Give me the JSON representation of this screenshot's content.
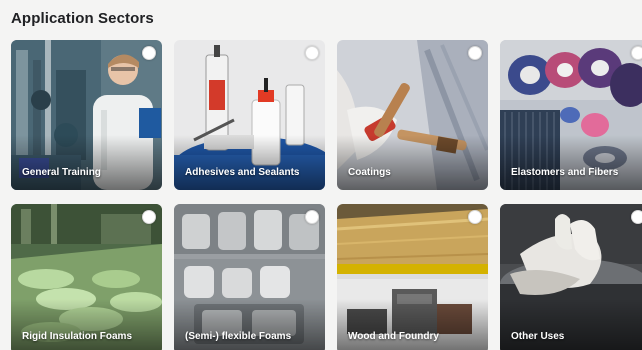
{
  "page": {
    "title": "Application Sectors"
  },
  "sectors": [
    {
      "label": "General Training",
      "icon": "industrial-worker-photo"
    },
    {
      "label": "Adhesives and Sealants",
      "icon": "adhesive-bottles-photo"
    },
    {
      "label": "Coatings",
      "icon": "paint-brush-photo"
    },
    {
      "label": "Elastomers and Fibers",
      "icon": "fiber-spools-photo"
    },
    {
      "label": "Rigid Insulation Foams",
      "icon": "foam-panels-photo"
    },
    {
      "label": "(Semi-) flexible Foams",
      "icon": "flexible-foam-molds-photo"
    },
    {
      "label": "Wood and Foundry",
      "icon": "wood-boards-photo"
    },
    {
      "label": "Other Uses",
      "icon": "gloved-hand-photo"
    }
  ],
  "colors": {
    "background": "#f4f4f3",
    "title_text": "#202124",
    "card_label": "#ffffff",
    "selector_radio": "#ffffff"
  }
}
